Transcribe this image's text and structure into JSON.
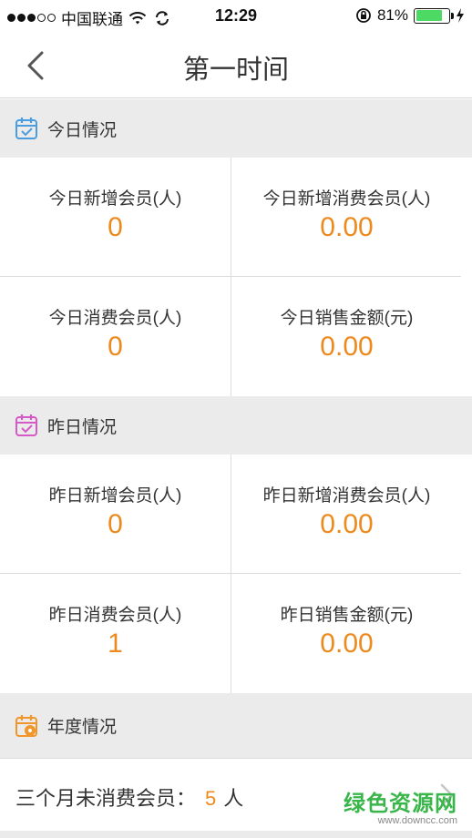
{
  "status_bar": {
    "carrier": "中国联通",
    "time": "12:29",
    "battery_percent": "81%",
    "battery_level": 0.81
  },
  "nav": {
    "title": "第一时间",
    "back_icon": "chevron-left-icon"
  },
  "colors": {
    "accent": "#ec8a1e",
    "today_icon": "#4a9ee0",
    "yesterday_icon": "#d659c8",
    "year_icon": "#f0962a",
    "section_bg": "#ebebeb"
  },
  "sections": [
    {
      "title": "今日情况",
      "icon": "calendar-check-icon",
      "cells": [
        {
          "title": "今日新增会员(人)",
          "value": "0"
        },
        {
          "title": "今日新增消费会员(人)",
          "value": "0.00"
        },
        {
          "title": "今日消费会员(人)",
          "value": "0"
        },
        {
          "title": "今日销售金额(元)",
          "value": "0.00"
        }
      ]
    },
    {
      "title": "昨日情况",
      "icon": "calendar-check-icon",
      "cells": [
        {
          "title": "昨日新增会员(人)",
          "value": "0"
        },
        {
          "title": "昨日新增消费会员(人)",
          "value": "0.00"
        },
        {
          "title": "昨日消费会员(人)",
          "value": "1"
        },
        {
          "title": "昨日销售金额(元)",
          "value": "0.00"
        }
      ]
    },
    {
      "title": "年度情况",
      "icon": "calendar-alert-icon"
    }
  ],
  "inactive_members": {
    "label": "三个月未消费会员：",
    "count": "5",
    "unit": "人"
  },
  "watermark": {
    "main": "绿色资源网",
    "sub": "www.downcc.com"
  }
}
